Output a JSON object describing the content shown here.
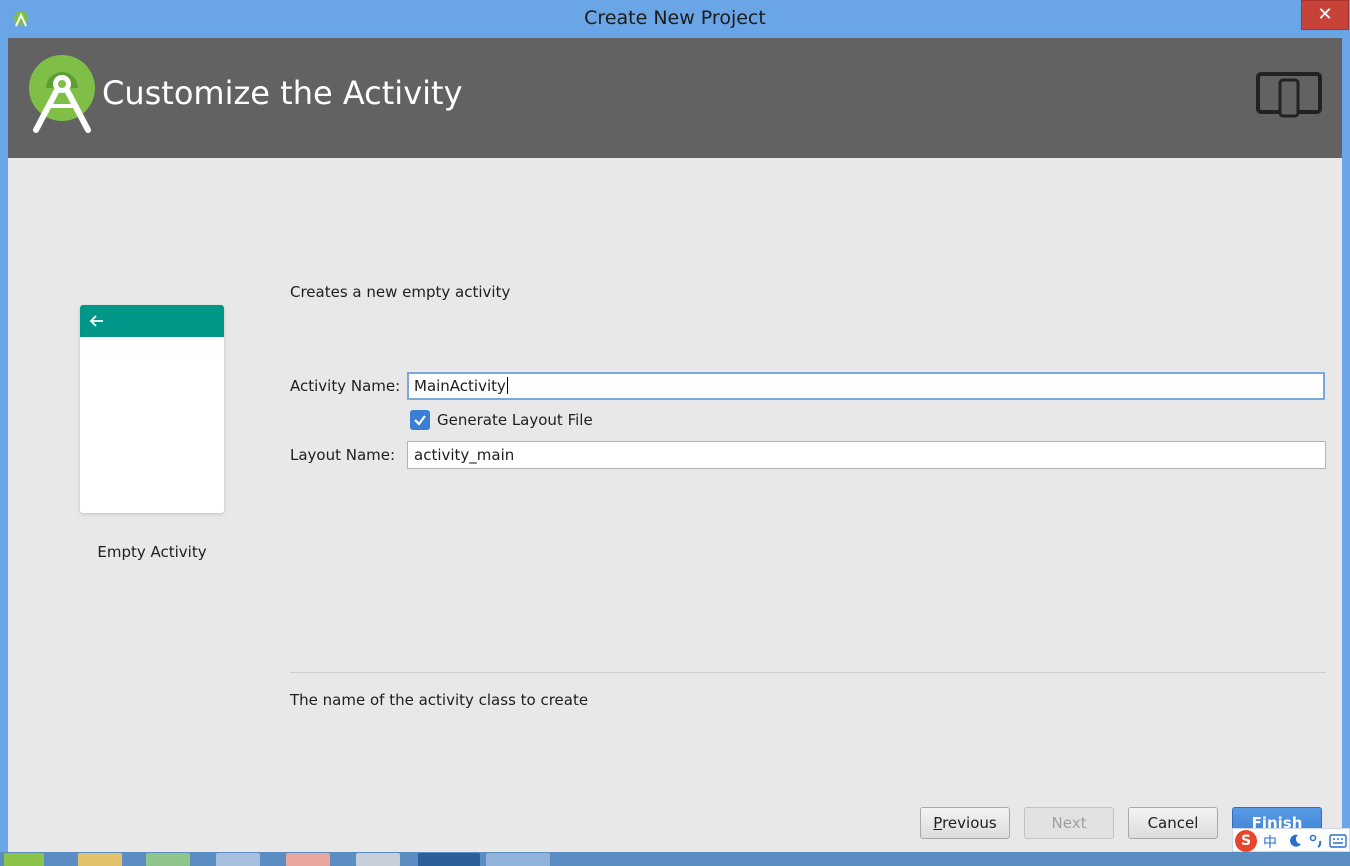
{
  "window": {
    "title": "Create New Project",
    "close_glyph": "✕"
  },
  "banner": {
    "heading": "Customize the Activity",
    "logo_icon": "android-studio-logo-icon",
    "device_icon": "tablet-phone-icon"
  },
  "template": {
    "name": "Empty Activity",
    "back_icon": "arrow-left-icon"
  },
  "form": {
    "description": "Creates a new empty activity",
    "activity_name_label": "Activity Name:",
    "activity_name_value": "MainActivity",
    "generate_layout_label": "Generate Layout File",
    "generate_layout_checked": true,
    "layout_name_label": "Layout Name:",
    "layout_name_value": "activity_main",
    "hint": "The name of the activity class to create"
  },
  "buttons": {
    "previous_first": "P",
    "previous_rest": "revious",
    "next": "Next",
    "cancel": "Cancel",
    "finish": "Finish"
  },
  "ime": {
    "logo": "S",
    "mode": "中"
  },
  "colors": {
    "titlebar": "#6aa6e6",
    "banner": "#626262",
    "appbar_teal": "#009688",
    "accent_blue": "#3b7fd4",
    "close_red": "#c7433a"
  }
}
